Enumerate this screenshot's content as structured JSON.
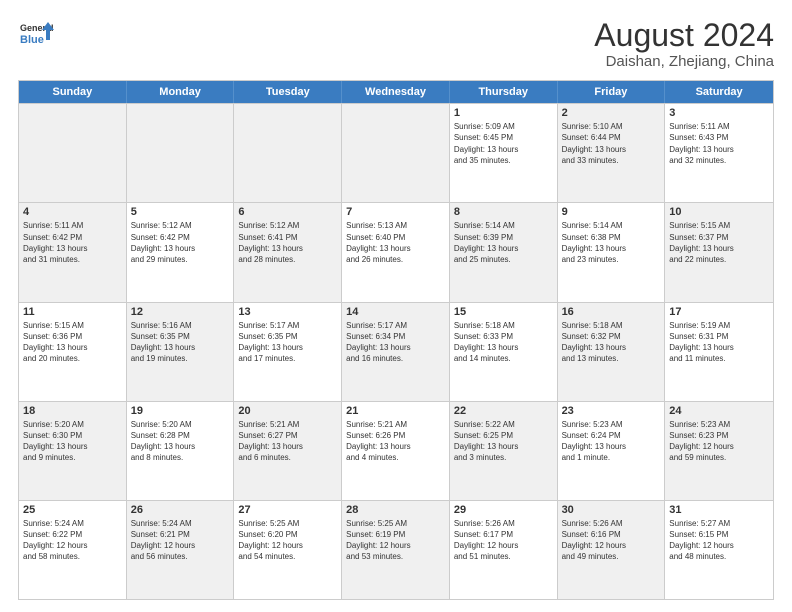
{
  "logo": {
    "line1": "General",
    "line2": "Blue"
  },
  "title": "August 2024",
  "subtitle": "Daishan, Zhejiang, China",
  "header_days": [
    "Sunday",
    "Monday",
    "Tuesday",
    "Wednesday",
    "Thursday",
    "Friday",
    "Saturday"
  ],
  "weeks": [
    [
      {
        "day": "",
        "info": "",
        "shade": true
      },
      {
        "day": "",
        "info": "",
        "shade": true
      },
      {
        "day": "",
        "info": "",
        "shade": true
      },
      {
        "day": "",
        "info": "",
        "shade": true
      },
      {
        "day": "1",
        "info": "Sunrise: 5:09 AM\nSunset: 6:45 PM\nDaylight: 13 hours\nand 35 minutes.",
        "shade": false
      },
      {
        "day": "2",
        "info": "Sunrise: 5:10 AM\nSunset: 6:44 PM\nDaylight: 13 hours\nand 33 minutes.",
        "shade": true
      },
      {
        "day": "3",
        "info": "Sunrise: 5:11 AM\nSunset: 6:43 PM\nDaylight: 13 hours\nand 32 minutes.",
        "shade": false
      }
    ],
    [
      {
        "day": "4",
        "info": "Sunrise: 5:11 AM\nSunset: 6:42 PM\nDaylight: 13 hours\nand 31 minutes.",
        "shade": true
      },
      {
        "day": "5",
        "info": "Sunrise: 5:12 AM\nSunset: 6:42 PM\nDaylight: 13 hours\nand 29 minutes.",
        "shade": false
      },
      {
        "day": "6",
        "info": "Sunrise: 5:12 AM\nSunset: 6:41 PM\nDaylight: 13 hours\nand 28 minutes.",
        "shade": true
      },
      {
        "day": "7",
        "info": "Sunrise: 5:13 AM\nSunset: 6:40 PM\nDaylight: 13 hours\nand 26 minutes.",
        "shade": false
      },
      {
        "day": "8",
        "info": "Sunrise: 5:14 AM\nSunset: 6:39 PM\nDaylight: 13 hours\nand 25 minutes.",
        "shade": true
      },
      {
        "day": "9",
        "info": "Sunrise: 5:14 AM\nSunset: 6:38 PM\nDaylight: 13 hours\nand 23 minutes.",
        "shade": false
      },
      {
        "day": "10",
        "info": "Sunrise: 5:15 AM\nSunset: 6:37 PM\nDaylight: 13 hours\nand 22 minutes.",
        "shade": true
      }
    ],
    [
      {
        "day": "11",
        "info": "Sunrise: 5:15 AM\nSunset: 6:36 PM\nDaylight: 13 hours\nand 20 minutes.",
        "shade": false
      },
      {
        "day": "12",
        "info": "Sunrise: 5:16 AM\nSunset: 6:35 PM\nDaylight: 13 hours\nand 19 minutes.",
        "shade": true
      },
      {
        "day": "13",
        "info": "Sunrise: 5:17 AM\nSunset: 6:35 PM\nDaylight: 13 hours\nand 17 minutes.",
        "shade": false
      },
      {
        "day": "14",
        "info": "Sunrise: 5:17 AM\nSunset: 6:34 PM\nDaylight: 13 hours\nand 16 minutes.",
        "shade": true
      },
      {
        "day": "15",
        "info": "Sunrise: 5:18 AM\nSunset: 6:33 PM\nDaylight: 13 hours\nand 14 minutes.",
        "shade": false
      },
      {
        "day": "16",
        "info": "Sunrise: 5:18 AM\nSunset: 6:32 PM\nDaylight: 13 hours\nand 13 minutes.",
        "shade": true
      },
      {
        "day": "17",
        "info": "Sunrise: 5:19 AM\nSunset: 6:31 PM\nDaylight: 13 hours\nand 11 minutes.",
        "shade": false
      }
    ],
    [
      {
        "day": "18",
        "info": "Sunrise: 5:20 AM\nSunset: 6:30 PM\nDaylight: 13 hours\nand 9 minutes.",
        "shade": true
      },
      {
        "day": "19",
        "info": "Sunrise: 5:20 AM\nSunset: 6:28 PM\nDaylight: 13 hours\nand 8 minutes.",
        "shade": false
      },
      {
        "day": "20",
        "info": "Sunrise: 5:21 AM\nSunset: 6:27 PM\nDaylight: 13 hours\nand 6 minutes.",
        "shade": true
      },
      {
        "day": "21",
        "info": "Sunrise: 5:21 AM\nSunset: 6:26 PM\nDaylight: 13 hours\nand 4 minutes.",
        "shade": false
      },
      {
        "day": "22",
        "info": "Sunrise: 5:22 AM\nSunset: 6:25 PM\nDaylight: 13 hours\nand 3 minutes.",
        "shade": true
      },
      {
        "day": "23",
        "info": "Sunrise: 5:23 AM\nSunset: 6:24 PM\nDaylight: 13 hours\nand 1 minute.",
        "shade": false
      },
      {
        "day": "24",
        "info": "Sunrise: 5:23 AM\nSunset: 6:23 PM\nDaylight: 12 hours\nand 59 minutes.",
        "shade": true
      }
    ],
    [
      {
        "day": "25",
        "info": "Sunrise: 5:24 AM\nSunset: 6:22 PM\nDaylight: 12 hours\nand 58 minutes.",
        "shade": false
      },
      {
        "day": "26",
        "info": "Sunrise: 5:24 AM\nSunset: 6:21 PM\nDaylight: 12 hours\nand 56 minutes.",
        "shade": true
      },
      {
        "day": "27",
        "info": "Sunrise: 5:25 AM\nSunset: 6:20 PM\nDaylight: 12 hours\nand 54 minutes.",
        "shade": false
      },
      {
        "day": "28",
        "info": "Sunrise: 5:25 AM\nSunset: 6:19 PM\nDaylight: 12 hours\nand 53 minutes.",
        "shade": true
      },
      {
        "day": "29",
        "info": "Sunrise: 5:26 AM\nSunset: 6:17 PM\nDaylight: 12 hours\nand 51 minutes.",
        "shade": false
      },
      {
        "day": "30",
        "info": "Sunrise: 5:26 AM\nSunset: 6:16 PM\nDaylight: 12 hours\nand 49 minutes.",
        "shade": true
      },
      {
        "day": "31",
        "info": "Sunrise: 5:27 AM\nSunset: 6:15 PM\nDaylight: 12 hours\nand 48 minutes.",
        "shade": false
      }
    ]
  ]
}
